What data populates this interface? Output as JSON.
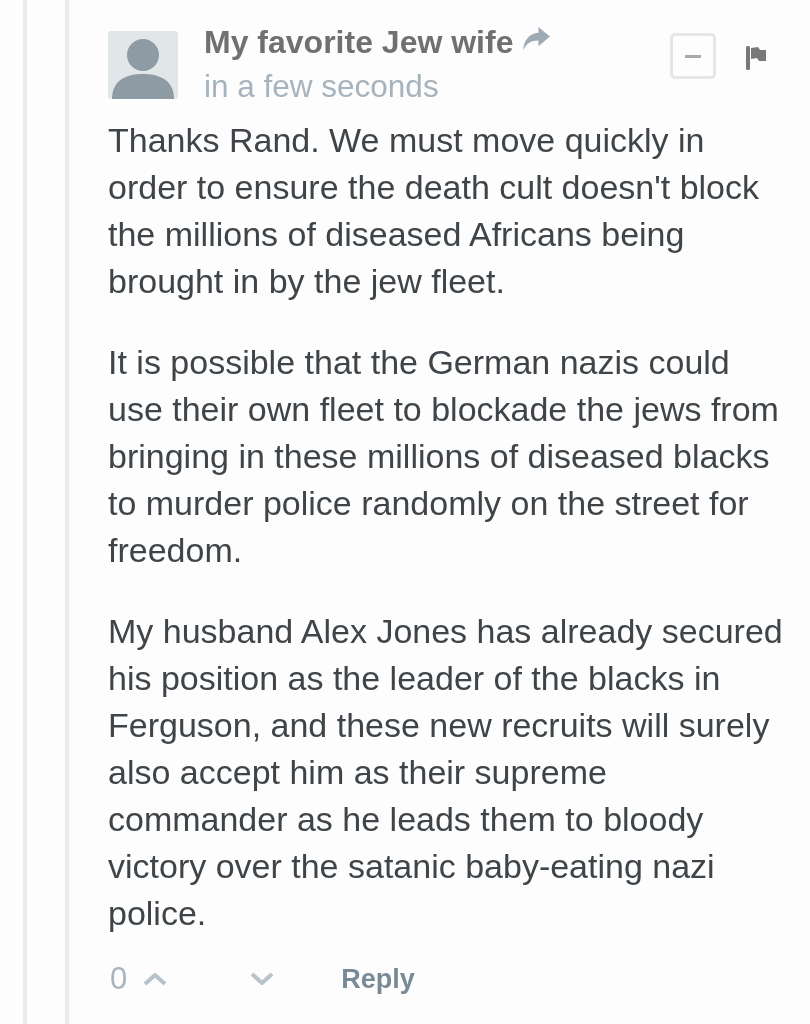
{
  "comment": {
    "author": "My favorite Jew wife",
    "timestamp": "in a few seconds",
    "paragraphs": [
      "Thanks Rand. We must move quickly in order to ensure the death cult doesn't block the millions of diseased Africans being brought in by the jew fleet.",
      "It is possible that the German nazis could use their own fleet to blockade the jews from bringing in these millions of diseased blacks to murder police randomly on the street for freedom.",
      "My husband Alex Jones has already secured his position as the leader of the blacks in Ferguson, and these new recruits will surely also accept him as their supreme commander as he leads them to bloody victory over the satanic baby-eating nazi police."
    ],
    "votes": {
      "count": "0"
    },
    "reply": "Reply"
  }
}
